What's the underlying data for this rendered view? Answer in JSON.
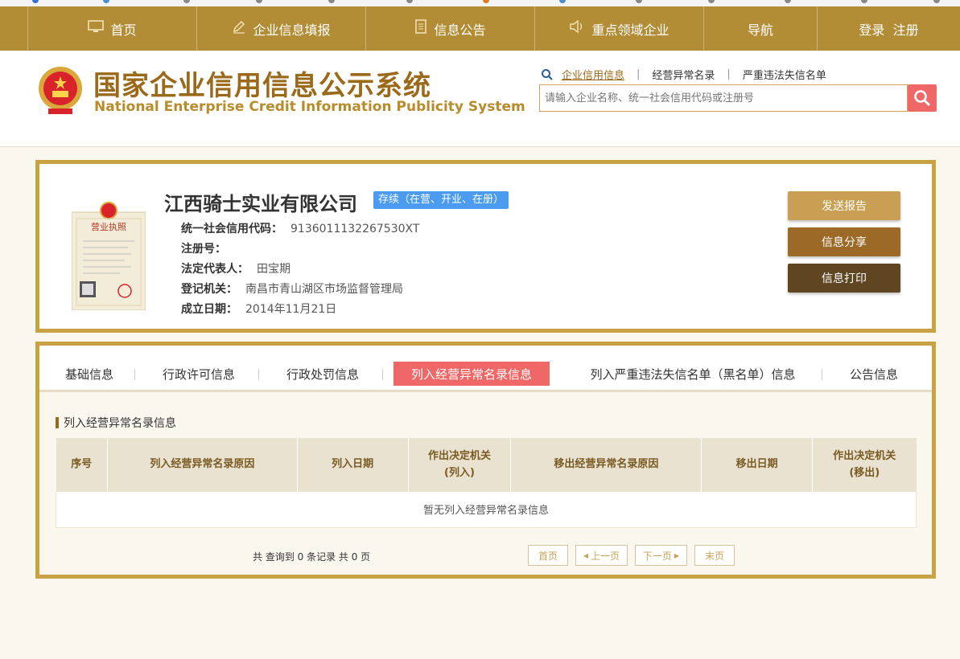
{
  "colors": {
    "nav_bg": "#b38d36",
    "accent_red": "#f06767",
    "status_blue": "#4b9bf0",
    "border_gold": "#c9a243"
  },
  "nav": {
    "items": [
      {
        "label": "首页",
        "icon": "monitor-icon"
      },
      {
        "label": "企业信息填报",
        "icon": "pen-icon"
      },
      {
        "label": "信息公告",
        "icon": "document-icon"
      },
      {
        "label": "重点领域企业",
        "icon": "speaker-icon"
      },
      {
        "label": "导航",
        "icon": ""
      },
      {
        "label": "登录  注册",
        "icon": ""
      }
    ]
  },
  "header": {
    "logo_cn": "国家企业信用信息公示系统",
    "logo_en": "National Enterprise Credit Information Publicity System"
  },
  "search": {
    "tabs": [
      "企业信用信息",
      "经营异常名录",
      "严重违法失信名单"
    ],
    "active_tab": 0,
    "placeholder": "请输入企业名称、统一社会信用代码或注册号"
  },
  "company": {
    "name": "江西骑士实业有限公司",
    "status": "存续（在营、开业、在册）",
    "fields": [
      {
        "label": "统一社会信用代码：",
        "value": "9136011132267530XT"
      },
      {
        "label": "注册号：",
        "value": ""
      },
      {
        "label": "法定代表人：",
        "value": "田宝期"
      },
      {
        "label": "登记机关：",
        "value": "南昌市青山湖区市场监督管理局"
      },
      {
        "label": "成立日期：",
        "value": "2014年11月21日"
      }
    ],
    "license_title": "营业执照"
  },
  "actions": {
    "send_report": "发送报告",
    "share": "信息分享",
    "print": "信息打印"
  },
  "tabs": {
    "items": [
      "基础信息",
      "行政许可信息",
      "行政处罚信息",
      "列入经营异常名录信息",
      "列入严重违法失信名单（黑名单）信息",
      "公告信息"
    ],
    "active": 3
  },
  "section": {
    "title": "列入经营异常名录信息",
    "columns": [
      "序号",
      "列入经营异常名录原因",
      "列入日期",
      "作出决定机关\n(列入)",
      "移出经营异常名录原因",
      "移出日期",
      "作出决定机关\n(移出)"
    ],
    "empty_text": "暂无列入经营异常名录信息"
  },
  "pagination": {
    "summary": "共 查询到 0 条记录 共 0 页",
    "first": "首页",
    "prev": "上一页",
    "next": "下一页",
    "last": "末页"
  }
}
